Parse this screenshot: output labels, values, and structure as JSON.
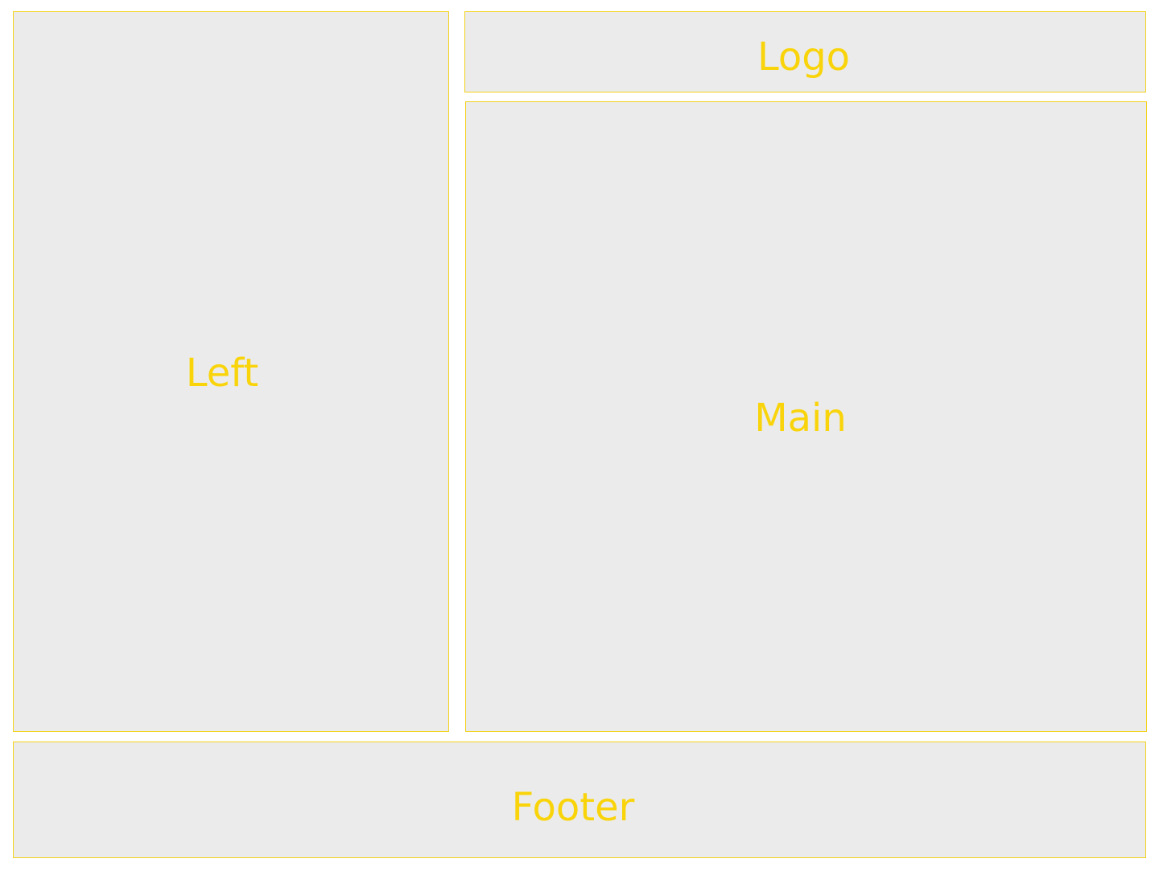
{
  "panels": {
    "left": "Left",
    "logo": "Logo",
    "main": "Main",
    "footer": "Footer"
  },
  "colors": {
    "panel_background": "#ebebeb",
    "panel_border": "#f2d21a",
    "label_text": "#f9d40a"
  }
}
